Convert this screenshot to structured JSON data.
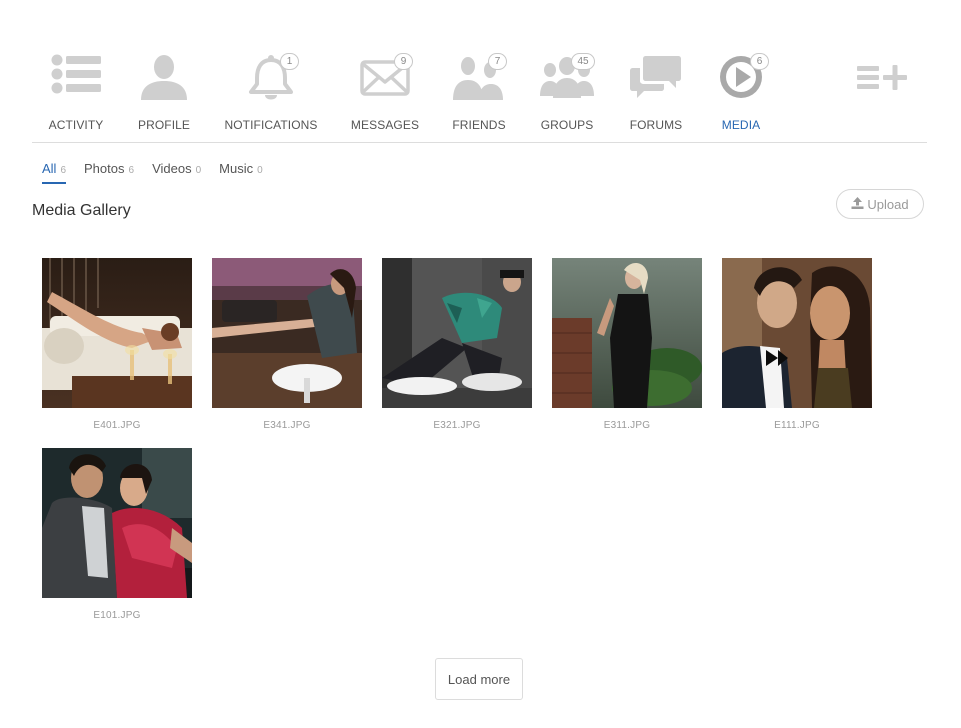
{
  "nav": {
    "items": [
      {
        "label": "ACTIVITY",
        "icon": "list-icon",
        "badge": null
      },
      {
        "label": "PROFILE",
        "icon": "user-icon",
        "badge": null
      },
      {
        "label": "NOTIFICATIONS",
        "icon": "bell-icon",
        "badge": "1"
      },
      {
        "label": "MESSAGES",
        "icon": "envelope-icon",
        "badge": "9"
      },
      {
        "label": "FRIENDS",
        "icon": "friends-icon",
        "badge": "7"
      },
      {
        "label": "GROUPS",
        "icon": "group-icon",
        "badge": "45"
      },
      {
        "label": "FORUMS",
        "icon": "chat-bubbles-icon",
        "badge": null
      },
      {
        "label": "MEDIA",
        "icon": "play-circle-icon",
        "badge": "6"
      }
    ],
    "active": "MEDIA",
    "add_icon": "list-add-icon"
  },
  "subtabs": [
    {
      "label": "All",
      "count": "6"
    },
    {
      "label": "Photos",
      "count": "6"
    },
    {
      "label": "Videos",
      "count": "0"
    },
    {
      "label": "Music",
      "count": "0"
    }
  ],
  "gallery": {
    "title": "Media Gallery",
    "upload_label": "Upload",
    "upload_icon": "upload-icon",
    "load_more_label": "Load more",
    "items": [
      {
        "caption": "E401.JPG"
      },
      {
        "caption": "E341.JPG"
      },
      {
        "caption": "E321.JPG"
      },
      {
        "caption": "E311.JPG"
      },
      {
        "caption": "E111.JPG"
      },
      {
        "caption": "E101.JPG"
      }
    ]
  },
  "colors": {
    "accent": "#2867b2",
    "icon_gray": "#cfcfcf",
    "active_icon": "#a9a9a9",
    "divider": "#dddddd"
  }
}
